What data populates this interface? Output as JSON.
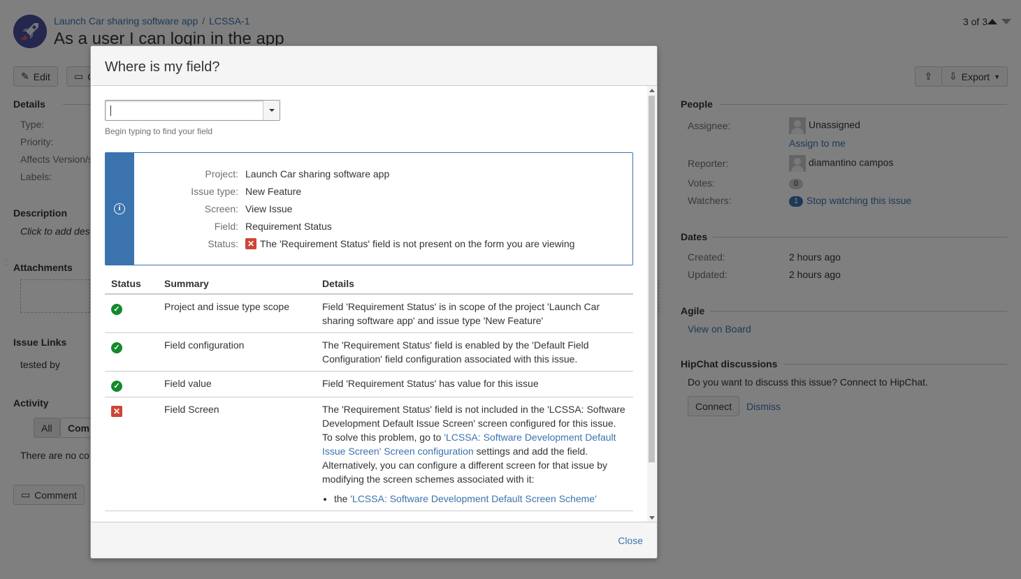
{
  "issue": {
    "project_link": "Launch Car sharing software app",
    "key": "LCSSA-1",
    "title": "As a user I can login in the app",
    "pager": "3 of 3"
  },
  "toolbar": {
    "edit_label": "Edit",
    "comment_label": "C",
    "export_label": "Export"
  },
  "left": {
    "details_heading": "Details",
    "type_label": "Type:",
    "priority_label": "Priority:",
    "affects_label": "Affects Version/s",
    "labels_label": "Labels:",
    "description_heading": "Description",
    "description_placeholder": "Click to add des",
    "attachments_heading": "Attachments",
    "issue_links_heading": "Issue Links",
    "tested_by": "tested by",
    "activity_heading": "Activity",
    "tab_all": "All",
    "tab_comments": "Comm",
    "no_comments": "There are no co",
    "comment_button": "Comment"
  },
  "right": {
    "people_heading": "People",
    "assignee_label": "Assignee:",
    "assignee_value": "Unassigned",
    "assign_to_me": "Assign to me",
    "reporter_label": "Reporter:",
    "reporter_value": "diamantino campos",
    "votes_label": "Votes:",
    "votes_count": "0",
    "watchers_label": "Watchers:",
    "watchers_count": "1",
    "stop_watching": "Stop watching this issue",
    "dates_heading": "Dates",
    "created_label": "Created:",
    "created_value": "2 hours ago",
    "updated_label": "Updated:",
    "updated_value": "2 hours ago",
    "agile_heading": "Agile",
    "view_on_board": "View on Board",
    "hipchat_heading": "HipChat discussions",
    "hipchat_text": "Do you want to discuss this issue? Connect to HipChat.",
    "connect_button": "Connect",
    "dismiss_link": "Dismiss"
  },
  "dialog": {
    "title": "Where is my field?",
    "search_value": "",
    "hint": "Begin typing to find your field",
    "info": {
      "project_label": "Project:",
      "project_value": "Launch Car sharing software app",
      "issue_type_label": "Issue type:",
      "issue_type_value": "New Feature",
      "screen_label": "Screen:",
      "screen_value": "View Issue",
      "field_label": "Field:",
      "field_value": "Requirement Status",
      "status_label": "Status:",
      "status_value": "The 'Requirement Status' field is not present on the form you are viewing"
    },
    "table": {
      "headers": [
        "Status",
        "Summary",
        "Details"
      ],
      "rows": [
        {
          "status": "ok",
          "summary": "Project and issue type scope",
          "details": "Field 'Requirement Status' is in scope of the project 'Launch Car sharing software app' and issue type 'New Feature'"
        },
        {
          "status": "ok",
          "summary": "Field configuration",
          "details": "The 'Requirement Status' field is enabled by the 'Default Field Configuration' field configuration associated with this issue."
        },
        {
          "status": "ok",
          "summary": "Field value",
          "details": "Field 'Requirement Status' has value for this issue"
        },
        {
          "status": "error",
          "summary": "Field Screen",
          "details_1": "The 'Requirement Status' field is not included in the 'LCSSA: Software Development Default Issue Screen' screen configured for this issue.",
          "details_2_pre": "To solve this problem, go to ",
          "details_2_link": "'LCSSA: Software Development Default Issue Screen' Screen configuration",
          "details_2_post": " settings and add the field.",
          "details_3": "Alternatively, you can configure a different screen for that issue by modifying the screen schemes associated with it:",
          "bullet_pre": "the ",
          "bullet_link": "'LCSSA: Software Development Default Screen Scheme'"
        }
      ]
    },
    "close_label": "Close"
  },
  "colors": {
    "link": "#3b73af",
    "info_accent": "#3b73af",
    "success": "#14892c",
    "error": "#d04437",
    "overlay": "rgba(0,0,0,0.5)"
  }
}
